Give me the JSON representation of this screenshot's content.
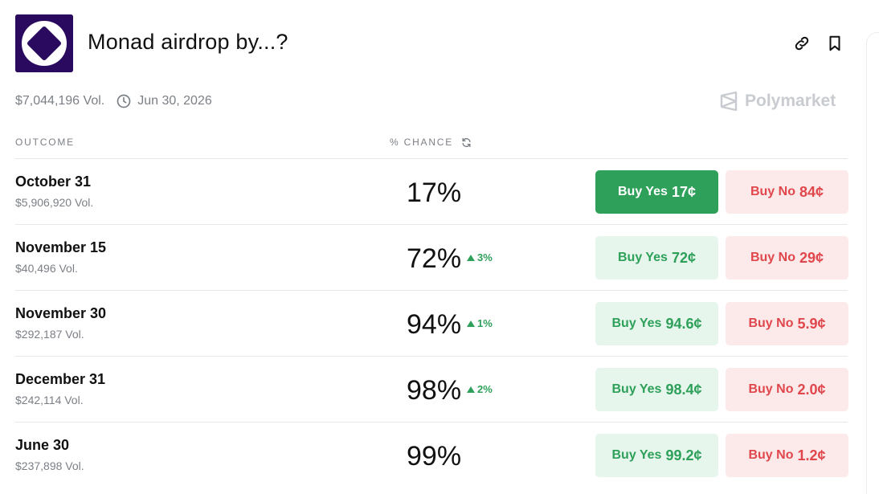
{
  "market": {
    "title": "Monad airdrop by...?",
    "volume": "$7,044,196 Vol.",
    "end_date": "Jun 30, 2026",
    "brand": "Polymarket"
  },
  "table": {
    "col_outcome": "OUTCOME",
    "col_chance": "% CHANCE",
    "rows": [
      {
        "name": "October 31",
        "vol": "$5,906,920 Vol.",
        "pct": "17%",
        "delta": "",
        "yes_label": "Buy Yes",
        "yes_price": "17¢",
        "no_label": "Buy No",
        "no_price": "84¢"
      },
      {
        "name": "November 15",
        "vol": "$40,496 Vol.",
        "pct": "72%",
        "delta": "3%",
        "yes_label": "Buy Yes",
        "yes_price": "72¢",
        "no_label": "Buy No",
        "no_price": "29¢"
      },
      {
        "name": "November 30",
        "vol": "$292,187 Vol.",
        "pct": "94%",
        "delta": "1%",
        "yes_label": "Buy Yes",
        "yes_price": "94.6¢",
        "no_label": "Buy No",
        "no_price": "5.9¢"
      },
      {
        "name": "December 31",
        "vol": "$242,114 Vol.",
        "pct": "98%",
        "delta": "2%",
        "yes_label": "Buy Yes",
        "yes_price": "98.4¢",
        "no_label": "Buy No",
        "no_price": "2.0¢"
      },
      {
        "name": "June 30",
        "vol": "$237,898 Vol.",
        "pct": "99%",
        "delta": "",
        "yes_label": "Buy Yes",
        "yes_price": "99.2¢",
        "no_label": "Buy No",
        "no_price": "1.2¢"
      }
    ]
  },
  "colors": {
    "yes_green": "#2ea05a",
    "no_red": "#e0474c",
    "logo_bg": "#2a0a5e"
  },
  "icons": {
    "logo": "monad-logo",
    "link": "link-icon",
    "bookmark": "bookmark-icon",
    "clock": "clock-icon",
    "refresh": "refresh-icon",
    "brand": "polymarket-logo-icon",
    "delta": "triangle-up-icon"
  }
}
